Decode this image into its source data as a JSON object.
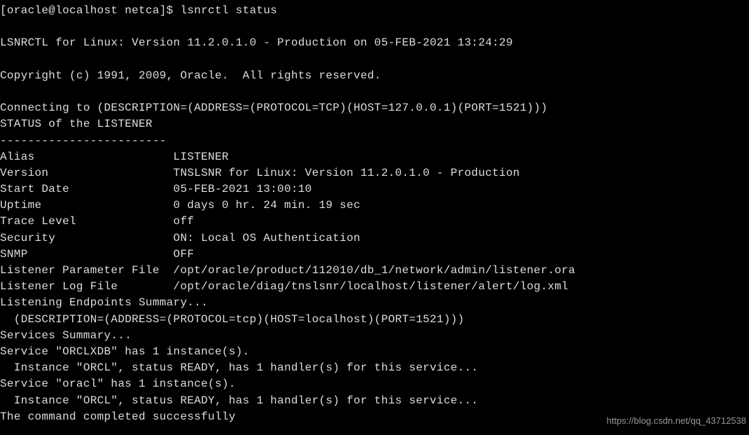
{
  "prompt": {
    "user_host_path": "[oracle@localhost netca]$ ",
    "command": "lsnrctl status"
  },
  "output": {
    "banner": "LSNRCTL for Linux: Version 11.2.0.1.0 - Production on 05-FEB-2021 13:24:29",
    "copyright": "Copyright (c) 1991, 2009, Oracle.  All rights reserved.",
    "connecting": "Connecting to (DESCRIPTION=(ADDRESS=(PROTOCOL=TCP)(HOST=127.0.0.1)(PORT=1521)))",
    "status_header": "STATUS of the LISTENER",
    "separator": "------------------------",
    "fields": [
      {
        "label": "Alias",
        "value": "LISTENER"
      },
      {
        "label": "Version",
        "value": "TNSLSNR for Linux: Version 11.2.0.1.0 - Production"
      },
      {
        "label": "Start Date",
        "value": "05-FEB-2021 13:00:10"
      },
      {
        "label": "Uptime",
        "value": "0 days 0 hr. 24 min. 19 sec"
      },
      {
        "label": "Trace Level",
        "value": "off"
      },
      {
        "label": "Security",
        "value": "ON: Local OS Authentication"
      },
      {
        "label": "SNMP",
        "value": "OFF"
      },
      {
        "label": "Listener Parameter File",
        "value": "/opt/oracle/product/112010/db_1/network/admin/listener.ora"
      },
      {
        "label": "Listener Log File",
        "value": "/opt/oracle/diag/tnslsnr/localhost/listener/alert/log.xml"
      }
    ],
    "endpoints_header": "Listening Endpoints Summary...",
    "endpoint_desc": "  (DESCRIPTION=(ADDRESS=(PROTOCOL=tcp)(HOST=localhost)(PORT=1521)))",
    "services_header": "Services Summary...",
    "services": [
      {
        "line": "Service \"ORCLXDB\" has 1 instance(s).",
        "instance": "  Instance \"ORCL\", status READY, has 1 handler(s) for this service..."
      },
      {
        "line": "Service \"oracl\" has 1 instance(s).",
        "instance": "  Instance \"ORCL\", status READY, has 1 handler(s) for this service..."
      }
    ],
    "completed": "The command completed successfully"
  },
  "watermark": "https://blog.csdn.net/qq_43712538"
}
